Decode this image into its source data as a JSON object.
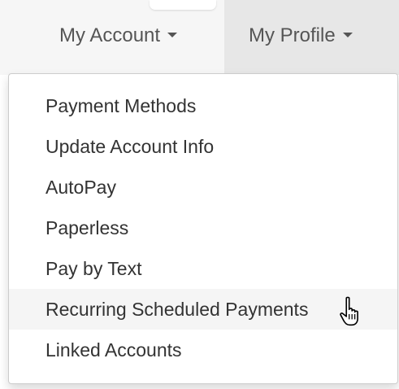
{
  "navbar": {
    "items": [
      {
        "label": "My Account"
      },
      {
        "label": "My Profile"
      }
    ]
  },
  "account_menu": {
    "items": [
      {
        "label": "Payment Methods"
      },
      {
        "label": "Update Account Info"
      },
      {
        "label": "AutoPay"
      },
      {
        "label": "Paperless"
      },
      {
        "label": "Pay by Text"
      },
      {
        "label": "Recurring Scheduled Payments"
      },
      {
        "label": "Linked Accounts"
      }
    ],
    "hovered_item": "Recurring Scheduled Payments"
  },
  "colors": {
    "navbar_bg": "#f6f6f6",
    "active_nav_bg": "#e7e7e7",
    "menu_bg": "#ffffff",
    "hover_bg": "#f5f5f5",
    "text": "#333333"
  },
  "icons": {
    "cursor": "hand-pointer-icon",
    "dropdown": "caret-down-icon"
  }
}
